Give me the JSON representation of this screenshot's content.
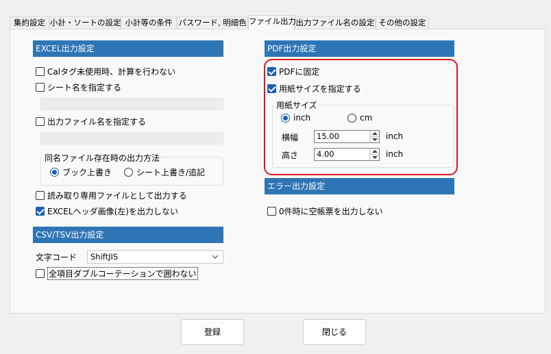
{
  "tabs": [
    "集約設定",
    "小計・ソートの設定",
    "小計等の条件",
    "パスワード, 明細色",
    "ファイル出力",
    "出力ファイル名の設定",
    "その他の設定"
  ],
  "active_tab": "ファイル出力",
  "excel": {
    "header": "EXCEL出力設定",
    "cal_tag": {
      "label": "Calタグ未使用時、計算を行わない",
      "checked": false
    },
    "sheet_name": {
      "label": "シート名を指定する",
      "checked": false
    },
    "output_filename": {
      "label": "出力ファイル名を指定する",
      "checked": false
    },
    "same_name_group": {
      "label": "同名ファイル存在時の出力方法",
      "options": [
        "ブック上書き",
        "シート上書き/追記"
      ],
      "selected": "ブック上書き"
    },
    "read_only": {
      "label": "読み取り専用ファイルとして出力する",
      "checked": false
    },
    "no_header_image": {
      "label": "EXCELヘッダ画像(左)を出力しない",
      "checked": true
    }
  },
  "csv": {
    "header": "CSV/TSV出力設定",
    "charset_label": "文字コード",
    "charset_value": "ShiftJIS",
    "no_double_quote": {
      "label": "全項目ダブルコーテーションで囲わない",
      "checked": false
    }
  },
  "pdf": {
    "header": "PDF出力設定",
    "fixed": {
      "label": "PDFに固定",
      "checked": true
    },
    "paper_size": {
      "label": "用紙サイズを指定する",
      "checked": true
    },
    "paper_group": {
      "label": "用紙サイズ",
      "units": [
        "inch",
        "cm"
      ],
      "selected_unit": "inch",
      "width_label": "横幅",
      "width_value": "15.00",
      "height_label": "高さ",
      "height_value": "4.00",
      "unit_suffix": "inch"
    }
  },
  "error": {
    "header": "エラー出力設定",
    "no_blank_form": {
      "label": "0件時に空帳票を出力しない",
      "checked": false
    }
  },
  "buttons": {
    "register": "登録",
    "close": "閉じる"
  },
  "colors": {
    "section_header": "#2e75b6",
    "highlight_border": "#e0141e",
    "checkbox_checked": "#1a5fb4"
  }
}
